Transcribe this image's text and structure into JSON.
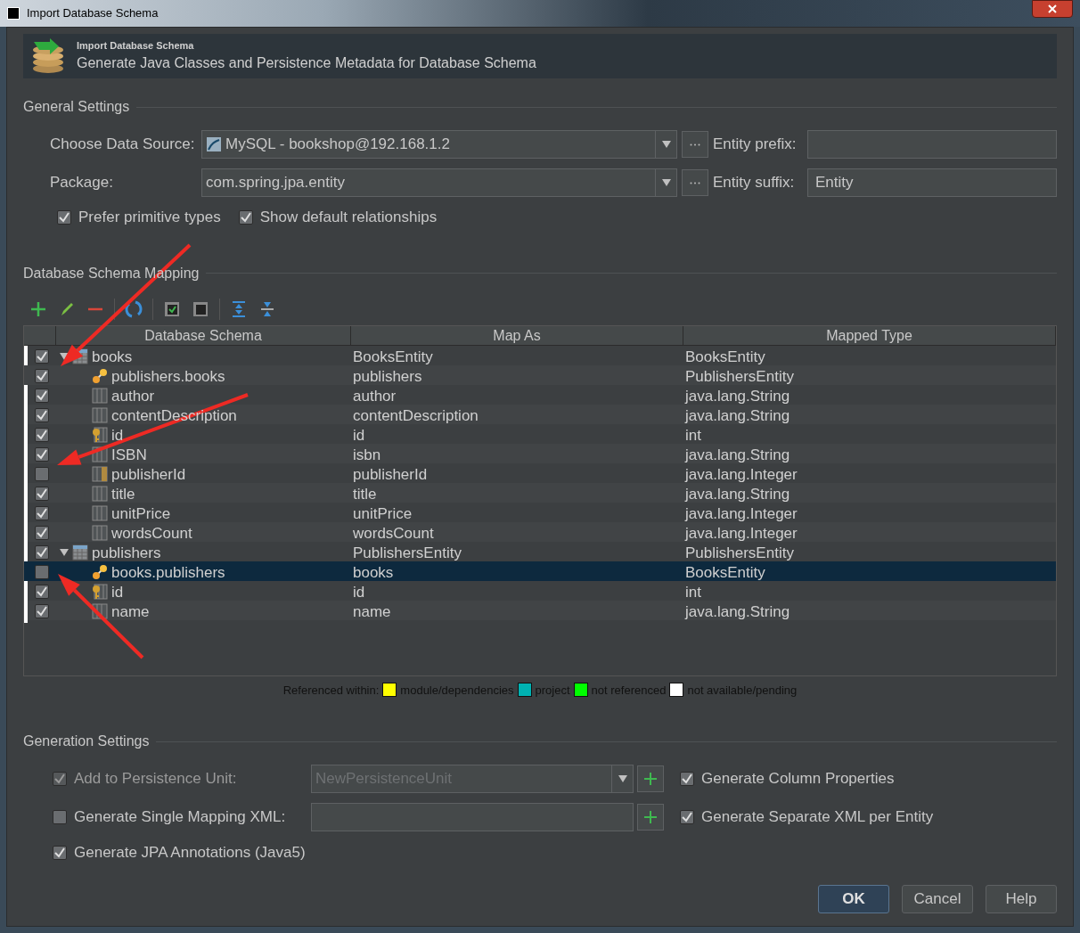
{
  "window": {
    "title": "Import Database Schema"
  },
  "header": {
    "title": "Import Database Schema",
    "subtitle": "Generate Java Classes and Persistence Metadata for Database Schema"
  },
  "general_settings": {
    "title": "General Settings",
    "data_source": {
      "label": "Choose Data Source:",
      "value": "MySQL - bookshop@192.168.1.2"
    },
    "package": {
      "label": "Package:",
      "value": "com.spring.jpa.entity"
    },
    "entity_prefix": {
      "label": "Entity prefix:"
    },
    "entity_suffix": {
      "label": "Entity suffix:",
      "value": "Entity"
    },
    "options": [
      {
        "label": "Prefer primitive types",
        "checked": true
      },
      {
        "label": "Show default relationships",
        "checked": true
      }
    ]
  },
  "mapping": {
    "title": "Database Schema Mapping",
    "columns": [
      "Database Schema",
      "Map As",
      "Mapped Type"
    ],
    "rows": [
      {
        "kind": "table",
        "name": "books",
        "map_as": "BooksEntity",
        "mapped_type": "BooksEntity",
        "checked": true,
        "expanded": true,
        "selected": false,
        "marked": true,
        "children": [
          {
            "kind": "relation",
            "name": "publishers.books",
            "map_as": "publishers",
            "mapped_type": "PublishersEntity",
            "checked": true,
            "selected": false,
            "marked": false
          },
          {
            "kind": "column",
            "name": "author",
            "map_as": "author",
            "mapped_type": "java.lang.String",
            "checked": true,
            "selected": false,
            "marked": true
          },
          {
            "kind": "column",
            "name": "contentDescription",
            "map_as": "contentDescription",
            "mapped_type": "java.lang.String",
            "checked": true,
            "selected": false,
            "marked": true
          },
          {
            "kind": "key",
            "name": "id",
            "map_as": "id",
            "mapped_type": "int",
            "checked": true,
            "selected": false,
            "marked": true
          },
          {
            "kind": "column",
            "name": "ISBN",
            "map_as": "isbn",
            "mapped_type": "java.lang.String",
            "checked": true,
            "selected": false,
            "marked": true
          },
          {
            "kind": "foreign_key",
            "name": "publisherId",
            "map_as": "publisherId",
            "mapped_type": "java.lang.Integer",
            "checked": false,
            "selected": false,
            "marked": true
          },
          {
            "kind": "column",
            "name": "title",
            "map_as": "title",
            "mapped_type": "java.lang.String",
            "checked": true,
            "selected": false,
            "marked": true
          },
          {
            "kind": "column",
            "name": "unitPrice",
            "map_as": "unitPrice",
            "mapped_type": "java.lang.Integer",
            "checked": true,
            "selected": false,
            "marked": true
          },
          {
            "kind": "column",
            "name": "wordsCount",
            "map_as": "wordsCount",
            "mapped_type": "java.lang.Integer",
            "checked": true,
            "selected": false,
            "marked": true
          }
        ]
      },
      {
        "kind": "table",
        "name": "publishers",
        "map_as": "PublishersEntity",
        "mapped_type": "PublishersEntity",
        "checked": true,
        "expanded": true,
        "selected": false,
        "marked": true,
        "children": [
          {
            "kind": "relation",
            "name": "books.publishers",
            "map_as": "books",
            "mapped_type": "BooksEntity",
            "checked": false,
            "selected": true,
            "marked": false
          },
          {
            "kind": "key",
            "name": "id",
            "map_as": "id",
            "mapped_type": "int",
            "checked": true,
            "selected": false,
            "marked": true
          },
          {
            "kind": "column",
            "name": "name",
            "map_as": "name",
            "mapped_type": "java.lang.String",
            "checked": true,
            "selected": false,
            "marked": true
          }
        ]
      }
    ]
  },
  "legend": {
    "label": "Referenced within:",
    "items": [
      {
        "label": "module/dependencies",
        "color": "#ffff00"
      },
      {
        "label": "project",
        "color": "#00b2b2"
      },
      {
        "label": "not referenced",
        "color": "#00ff00"
      },
      {
        "label": "not available/pending",
        "color": "#ffffff"
      }
    ]
  },
  "generation_settings": {
    "title": "Generation Settings",
    "persistence_unit": {
      "label": "Add to Persistence Unit:",
      "checked": true,
      "disabled": true,
      "value": "NewPersistenceUnit"
    },
    "mapping_xml": {
      "label": "Generate Single Mapping XML:",
      "checked": false,
      "disabled": false
    },
    "jpa_annotations": {
      "label": "Generate JPA Annotations (Java5)",
      "checked": true
    },
    "column_properties": {
      "label": "Generate Column Properties",
      "checked": true
    },
    "separate_xml": {
      "label": "Generate Separate XML per Entity",
      "checked": true
    }
  },
  "buttons": [
    {
      "label": "OK",
      "default": true
    },
    {
      "label": "Cancel",
      "default": false
    },
    {
      "label": "Help",
      "default": false
    }
  ]
}
